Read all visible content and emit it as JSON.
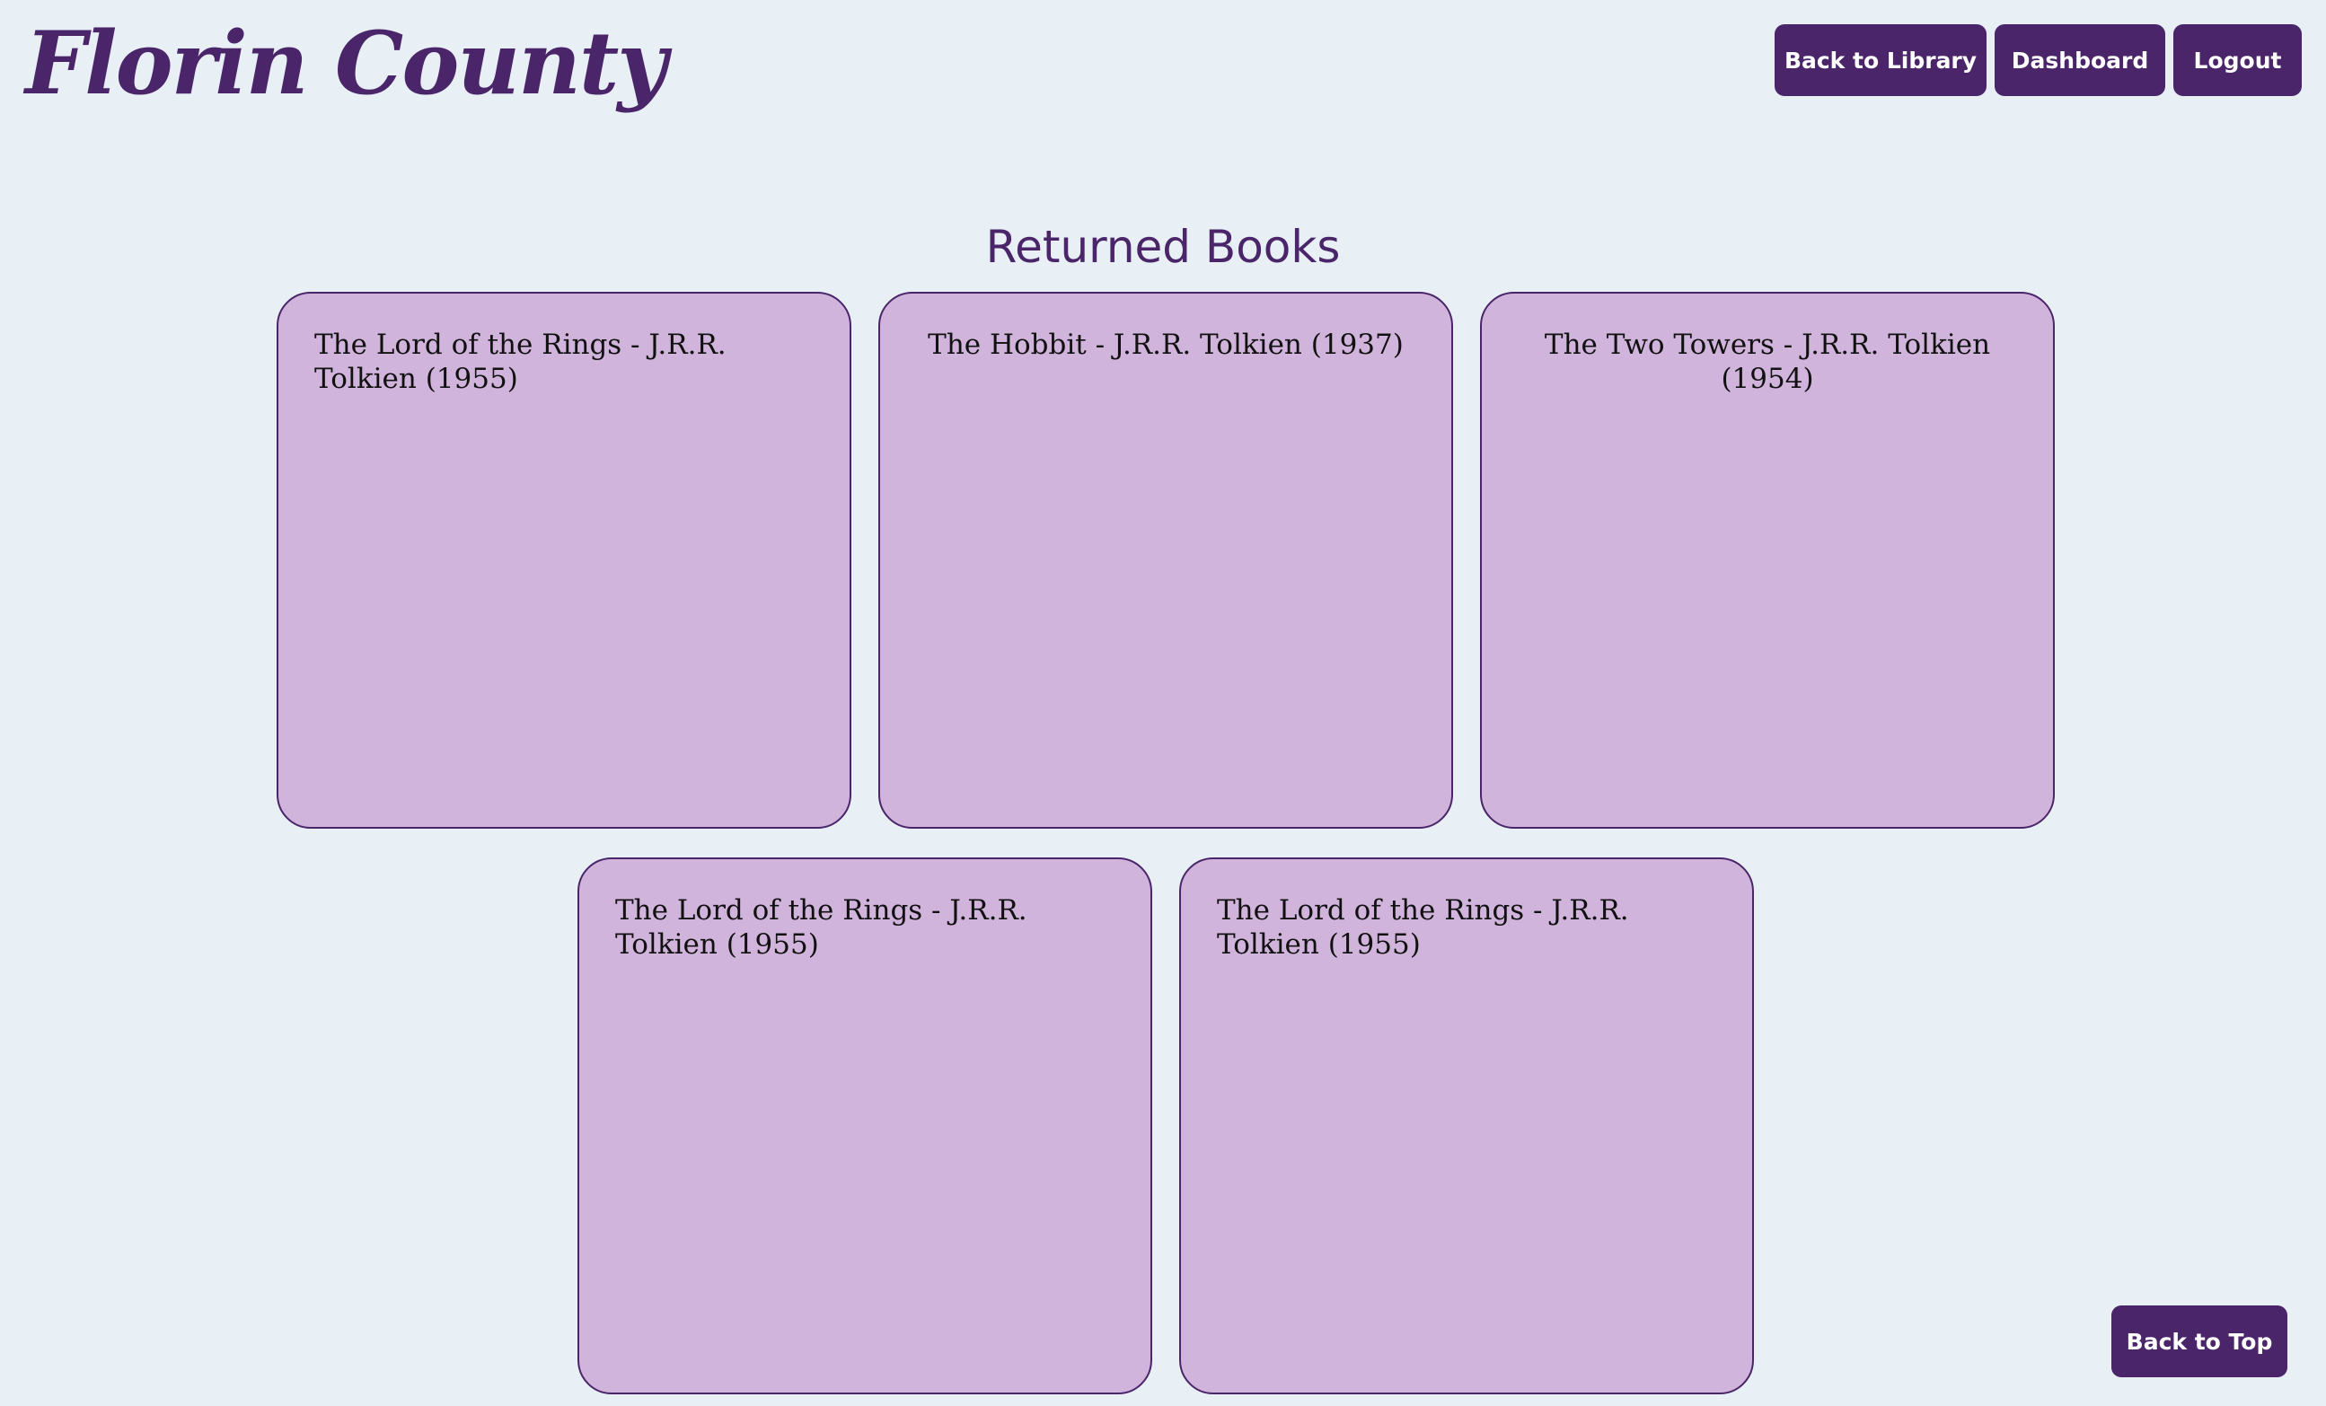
{
  "brand": {
    "name": "Florin County"
  },
  "nav": {
    "back_to_library": "Back to Library",
    "dashboard": "Dashboard",
    "logout": "Logout"
  },
  "page": {
    "title": "Returned Books"
  },
  "books": [
    {
      "title": "The Lord of the Rings - J.R.R. Tolkien (1955)"
    },
    {
      "title": "The Hobbit - J.R.R. Tolkien (1937)"
    },
    {
      "title": "The Two Towers - J.R.R. Tolkien (1954)"
    },
    {
      "title": "The Lord of the Rings - J.R.R. Tolkien (1955)"
    },
    {
      "title": "The Lord of the Rings - J.R.R. Tolkien (1955)"
    }
  ],
  "footer": {
    "back_to_top": "Back to Top"
  },
  "colors": {
    "background": "#e8f0f6",
    "primary": "#4b2569",
    "card": "#d1b4dc"
  }
}
